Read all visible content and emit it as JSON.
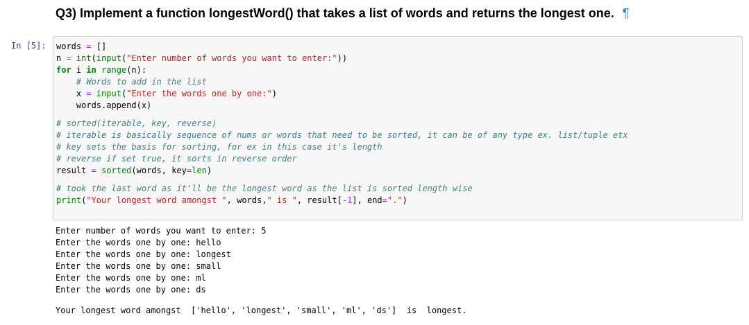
{
  "markdown": {
    "heading": "Q3) Implement a function longestWord() that takes a list of words and returns the longest one.",
    "pilcrow": "¶"
  },
  "cell": {
    "prompt": "In [5]:"
  },
  "code": {
    "l1": {
      "a": "words ",
      "b": "=",
      "c": " []"
    },
    "l2": {
      "a": "n ",
      "b": "=",
      "c": " ",
      "d": "int",
      "e": "(",
      "f": "input",
      "g": "(",
      "h": "\"Enter number of words you want to enter:\"",
      "i": "))"
    },
    "l3": {
      "a": "for",
      "b": " i ",
      "c": "in",
      "d": " ",
      "e": "range",
      "f": "(n):"
    },
    "l4": {
      "a": "    ",
      "b": "# Words to add in the list"
    },
    "l5": {
      "a": "    x ",
      "b": "=",
      "c": " ",
      "d": "input",
      "e": "(",
      "f": "\"Enter the words one by one:\"",
      "g": ")"
    },
    "l6": {
      "a": "    words.append(x)"
    },
    "l7": {
      "a": "# sorted(iterable, key, reverse)"
    },
    "l8": {
      "a": "# iterable is basically sequence of nums or words that need to be sorted, it can be of any type ex. list/tuple etx"
    },
    "l9": {
      "a": "# key sets the basis for sorting, for ex in this case it's length"
    },
    "l10": {
      "a": "# reverse if set true, it sorts in reverse order"
    },
    "l11": {
      "a": "result ",
      "b": "=",
      "c": " ",
      "d": "sorted",
      "e": "(words, key",
      "f": "=",
      "g": "len",
      "h": ")"
    },
    "l12": {
      "a": "# took the last word as it'll be the longest word as the list is sorted length wise"
    },
    "l13": {
      "a": "print",
      "b": "(",
      "c": "\"Your longest word amongst \"",
      "d": ", words,",
      "e": "\" is \"",
      "f": ", result[",
      "g": "-1",
      "h": "], end",
      "i": "=",
      "j": "\".\"",
      "k": ")"
    }
  },
  "output": {
    "lines": [
      "Enter number of words you want to enter: 5",
      "Enter the words one by one: hello",
      "Enter the words one by one: longest",
      "Enter the words one by one: small",
      "Enter the words one by one: ml",
      "Enter the words one by one: ds"
    ],
    "result": "Your longest word amongst  ['hello', 'longest', 'small', 'ml', 'ds']  is  longest."
  }
}
